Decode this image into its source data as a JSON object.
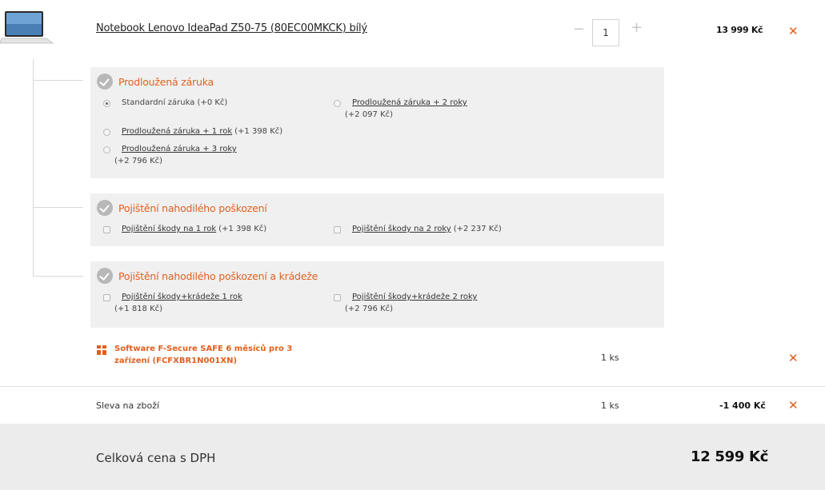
{
  "product": {
    "title": "Notebook Lenovo IdeaPad Z50-75 (80EC00MKCK) bílý",
    "quantity": "1",
    "minus": "−",
    "plus": "+",
    "price": "13 999 Kč",
    "remove": "✕",
    "thumbnail_icon": "laptop-icon"
  },
  "warranty": {
    "title": "Prodloužená záruka",
    "options": [
      {
        "label": "Standardní záruka (+0 Kč)",
        "selected": true
      },
      {
        "label": "Prodloužená záruka + 2 roky",
        "price": "(+2 097 Kč)",
        "selected": false
      },
      {
        "label": "Prodloužená záruka + 1 rok",
        "price": "(+1 398 Kč)",
        "selected": false
      },
      {
        "label": "Prodloužená záruka + 3 roky",
        "price": "(+2 796 Kč)",
        "selected": false
      }
    ]
  },
  "insurance": {
    "title": "Pojištění nahodilého poškození",
    "options": [
      {
        "label": "Pojištění škody na 1 rok",
        "price": "(+1 398 Kč)",
        "checked": false
      },
      {
        "label": "Pojištění škody na 2 roky",
        "price": "(+2 237 Kč)",
        "checked": false
      }
    ]
  },
  "theft": {
    "title": "Pojištění nahodilého poškození a krádeže",
    "options": [
      {
        "label": "Pojištění škody+krádeže 1 rok",
        "price": "(+1 818 Kč)",
        "checked": false
      },
      {
        "label": "Pojištění škody+krádeže 2 roky",
        "price": "(+2 796 Kč)",
        "checked": false
      }
    ]
  },
  "gift": {
    "title": "Software F-Secure SAFE 6 měsíců pro 3 zařízení (FCFXBR1N001XN)",
    "qty": "1 ks",
    "remove": "✕"
  },
  "discount": {
    "label": "Sleva na zboží",
    "qty": "1 ks",
    "value": "-1 400 Kč",
    "remove": "✕"
  },
  "total": {
    "label": "Celková cena s DPH",
    "value": "12 599 Kč"
  },
  "colors": {
    "accent": "#e65d1b",
    "panel_bg": "#f0f0f0",
    "total_bg": "#ececec"
  }
}
